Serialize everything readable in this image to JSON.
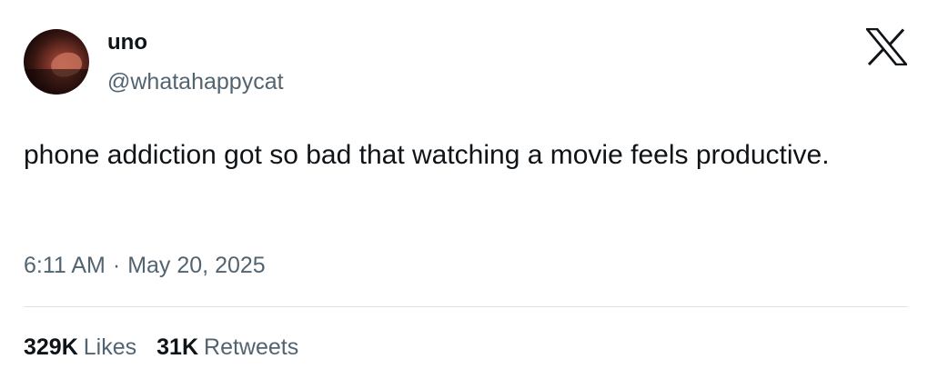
{
  "author": {
    "display_name": "uno",
    "handle": "@whatahappycat",
    "avatar_icon": "avatar-photo"
  },
  "platform": {
    "logo_icon": "x-logo-icon"
  },
  "tweet": {
    "text": "phone addiction got so bad that watching a movie feels productive.",
    "time": "6:11 AM",
    "separator": "·",
    "date": "May 20, 2025"
  },
  "stats": {
    "likes_count": "329K",
    "likes_label": "Likes",
    "retweets_count": "31K",
    "retweets_label": "Retweets"
  },
  "colors": {
    "primary_text": "#0f1419",
    "secondary_text": "#536471",
    "divider": "#e1e4e7",
    "background": "#ffffff"
  }
}
